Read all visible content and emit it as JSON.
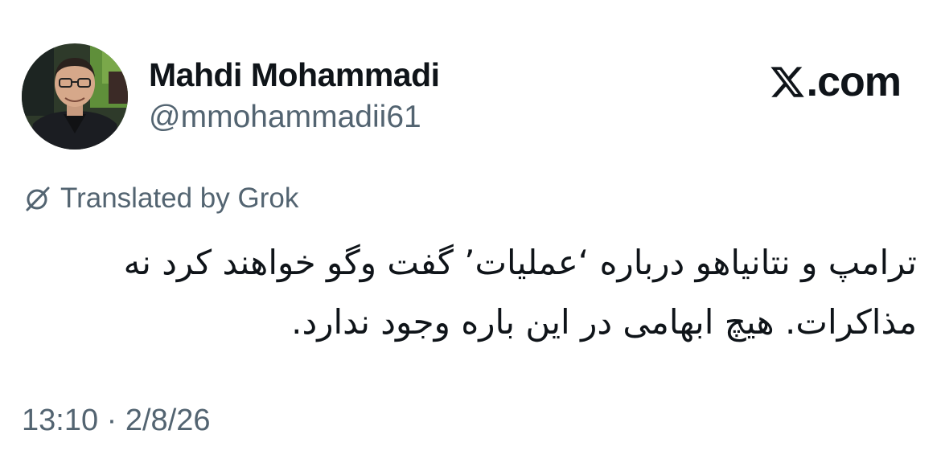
{
  "tweet": {
    "author": {
      "display_name": "Mahdi Mohammadi",
      "handle": "@mmohammadii61",
      "avatar_icon": "profile-photo"
    },
    "brand": {
      "icon": "x-logo-icon",
      "text": ".com"
    },
    "translation_note": {
      "icon": "grok-icon",
      "label": "Translated by Grok"
    },
    "text": "ترامپ و نتانیاهو درباره ‘عملیات’ گفت وگو خواهند کرد نه مذاکرات. هیچ ابهامی در این باره وجود ندارد.",
    "timestamp": "13:10 · 2/8/26"
  },
  "colors": {
    "text_primary": "#0f1419",
    "text_secondary": "#536471",
    "background": "#ffffff"
  }
}
